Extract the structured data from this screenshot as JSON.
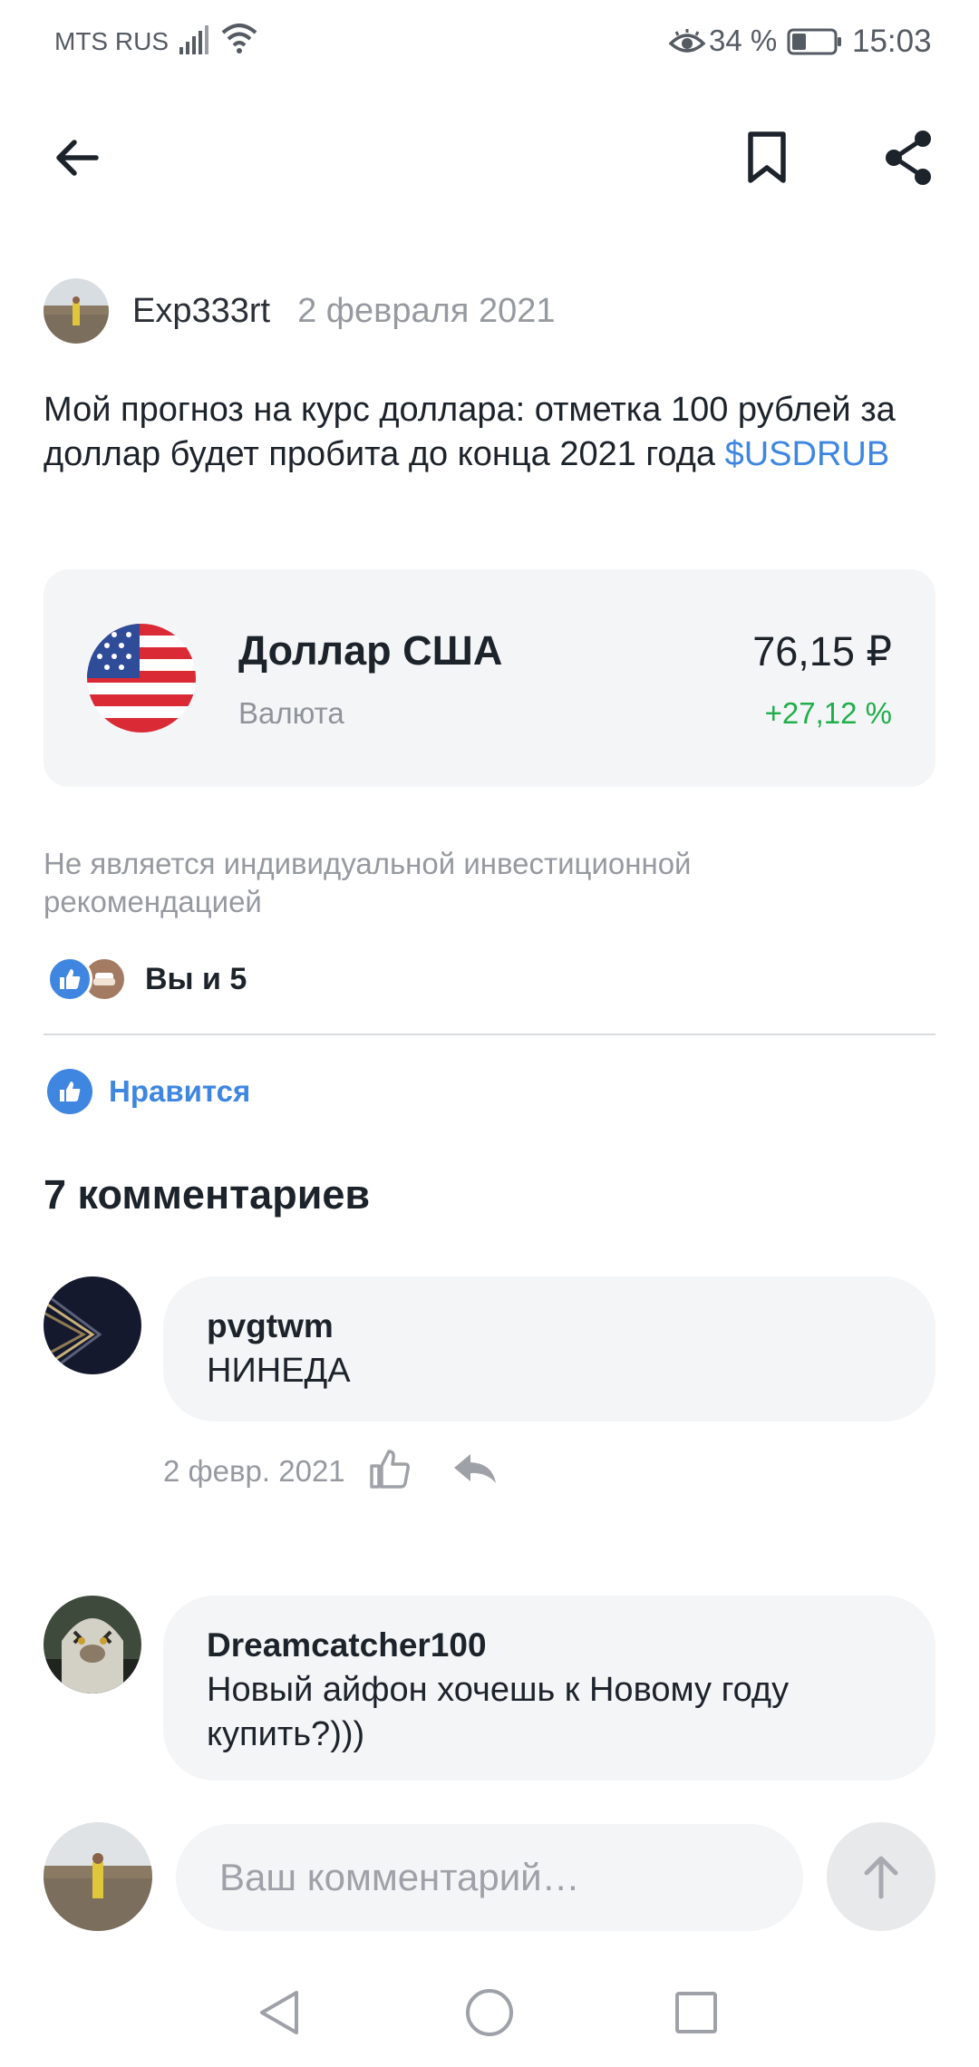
{
  "status_bar": {
    "carrier": "MTS RUS",
    "battery_percent": "34 %",
    "battery_level": 0.34,
    "time": "15:03"
  },
  "toolbar": {
    "back_icon": "arrow-left-icon",
    "bookmark_icon": "bookmark-icon",
    "share_icon": "share-icon"
  },
  "post": {
    "author": "Exp333rt",
    "date": "2 февраля 2021",
    "text": "Мой прогноз на курс доллара: отметка 100 рублей за доллар будет пробита до конца 2021 года ",
    "ticker": "$USDRUB",
    "instrument": {
      "name": "Доллар США",
      "type": "Валюта",
      "price": "76,15 ₽",
      "change": "+27,12 %",
      "change_color": "#1fae4a"
    },
    "disclaimer": "Не является индивидуальной инвестиционной рекомендацией",
    "likes_summary": "Вы и 5",
    "like_button_label": "Нравится"
  },
  "comments_section": {
    "title": "7 комментариев",
    "items": [
      {
        "author": "pvgtwm",
        "text": "НИНЕДА",
        "date": "2 февр. 2021"
      },
      {
        "author": "Dreamcatcher100",
        "text": "Новый айфон хочешь к Новому году купить?)))"
      }
    ]
  },
  "comment_input": {
    "placeholder": "Ваш комментарий…"
  },
  "colors": {
    "accent": "#3f86e0",
    "positive": "#1fae4a",
    "muted": "#969aa0",
    "card_bg": "#f4f5f7"
  }
}
